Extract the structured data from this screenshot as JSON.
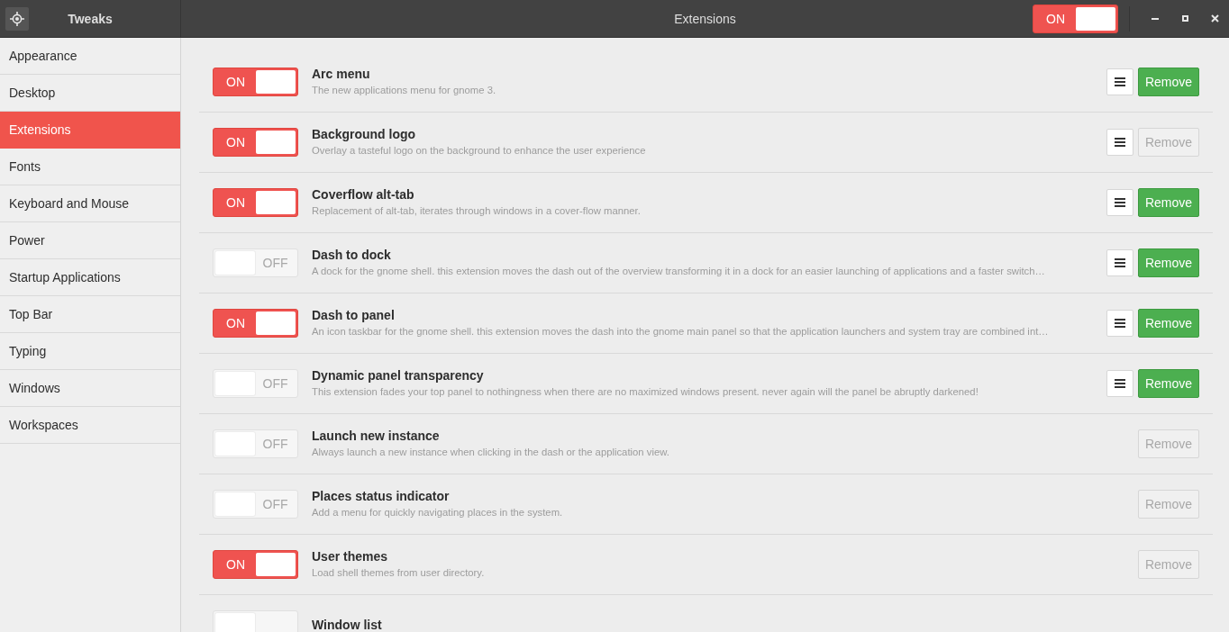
{
  "header": {
    "app_title": "Tweaks",
    "page_title": "Extensions",
    "master_switch": {
      "on": true,
      "label": "ON"
    }
  },
  "sidebar": {
    "items": [
      {
        "label": "Appearance",
        "selected": false
      },
      {
        "label": "Desktop",
        "selected": false
      },
      {
        "label": "Extensions",
        "selected": true
      },
      {
        "label": "Fonts",
        "selected": false
      },
      {
        "label": "Keyboard and Mouse",
        "selected": false
      },
      {
        "label": "Power",
        "selected": false
      },
      {
        "label": "Startup Applications",
        "selected": false
      },
      {
        "label": "Top Bar",
        "selected": false
      },
      {
        "label": "Typing",
        "selected": false
      },
      {
        "label": "Windows",
        "selected": false
      },
      {
        "label": "Workspaces",
        "selected": false
      }
    ]
  },
  "extensions": [
    {
      "name": "Arc menu",
      "description": "The new applications menu for gnome 3.",
      "switch": {
        "on": true,
        "label": "ON"
      },
      "settings_button": true,
      "remove": {
        "label": "Remove",
        "disabled": false
      }
    },
    {
      "name": "Background logo",
      "description": "Overlay a tasteful logo on the background to enhance the user experience",
      "switch": {
        "on": true,
        "label": "ON"
      },
      "settings_button": true,
      "remove": {
        "label": "Remove",
        "disabled": true
      }
    },
    {
      "name": "Coverflow alt-tab",
      "description": "Replacement of alt-tab, iterates through windows in a cover-flow manner.",
      "switch": {
        "on": true,
        "label": "ON"
      },
      "settings_button": true,
      "remove": {
        "label": "Remove",
        "disabled": false
      }
    },
    {
      "name": "Dash to dock",
      "description": "A dock for the gnome shell. this extension moves the dash out of the overview transforming it in a dock for an easier launching of applications and a faster switch…",
      "switch": {
        "on": false,
        "label": "OFF"
      },
      "settings_button": true,
      "remove": {
        "label": "Remove",
        "disabled": false
      }
    },
    {
      "name": "Dash to panel",
      "description": "An icon taskbar for the gnome shell. this extension moves the dash into the gnome main panel so that the application launchers and system tray are combined int…",
      "switch": {
        "on": true,
        "label": "ON"
      },
      "settings_button": true,
      "remove": {
        "label": "Remove",
        "disabled": false
      }
    },
    {
      "name": "Dynamic panel transparency",
      "description": "This extension fades your top panel to nothingness when there are no maximized windows present. never again will the panel be abruptly darkened!",
      "switch": {
        "on": false,
        "label": "OFF"
      },
      "settings_button": true,
      "remove": {
        "label": "Remove",
        "disabled": false
      }
    },
    {
      "name": "Launch new instance",
      "description": "Always launch a new instance when clicking in the dash or the application view.",
      "switch": {
        "on": false,
        "label": "OFF"
      },
      "settings_button": false,
      "remove": {
        "label": "Remove",
        "disabled": true
      }
    },
    {
      "name": "Places status indicator",
      "description": "Add a menu for quickly navigating places in the system.",
      "switch": {
        "on": false,
        "label": "OFF"
      },
      "settings_button": false,
      "remove": {
        "label": "Remove",
        "disabled": true
      }
    },
    {
      "name": "User themes",
      "description": "Load shell themes from user directory.",
      "switch": {
        "on": true,
        "label": "ON"
      },
      "settings_button": false,
      "remove": {
        "label": "Remove",
        "disabled": true
      }
    },
    {
      "name": "Window list",
      "switch": {
        "on": false
      }
    }
  ]
}
